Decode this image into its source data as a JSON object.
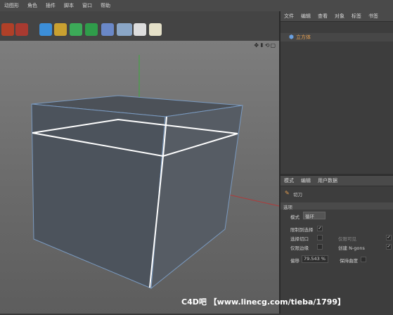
{
  "menubar": {
    "items": [
      "动图形",
      "角色",
      "插件",
      "脚本",
      "窗口",
      "帮助"
    ]
  },
  "viewport": {
    "nav_icons": "✥⬍⟲▢"
  },
  "object_manager": {
    "menu": [
      "文件",
      "编辑",
      "查看",
      "对象",
      "标签",
      "书签"
    ],
    "object_name": "立方体"
  },
  "attributes": {
    "menu": [
      "模式",
      "编辑",
      "用户数据"
    ],
    "tool_name": "切刀",
    "section": "选项",
    "mode_label": "模式",
    "mode_value": "循环",
    "restrict_label": "限制到选择",
    "select_cuts_label": "选择切口",
    "visible_only_label": "仅限可见",
    "edge_only_label": "仅限边缘",
    "create_ngons_label": "创建 N-gons",
    "offset_label": "偏移",
    "offset_value": "79.543 %",
    "keep_curvature_label": "保持曲度",
    "checks": {
      "restrict": "✓",
      "create_ngons": "✓",
      "visible_only": "✓"
    }
  },
  "watermark": "C4D吧 【www.linecg.com/tieba/1799】",
  "colors": {
    "accent": "#e8a050",
    "viewport_bg": "#6f6f6f",
    "selected_edge": "#ffffff",
    "cube_face": "#515862"
  }
}
